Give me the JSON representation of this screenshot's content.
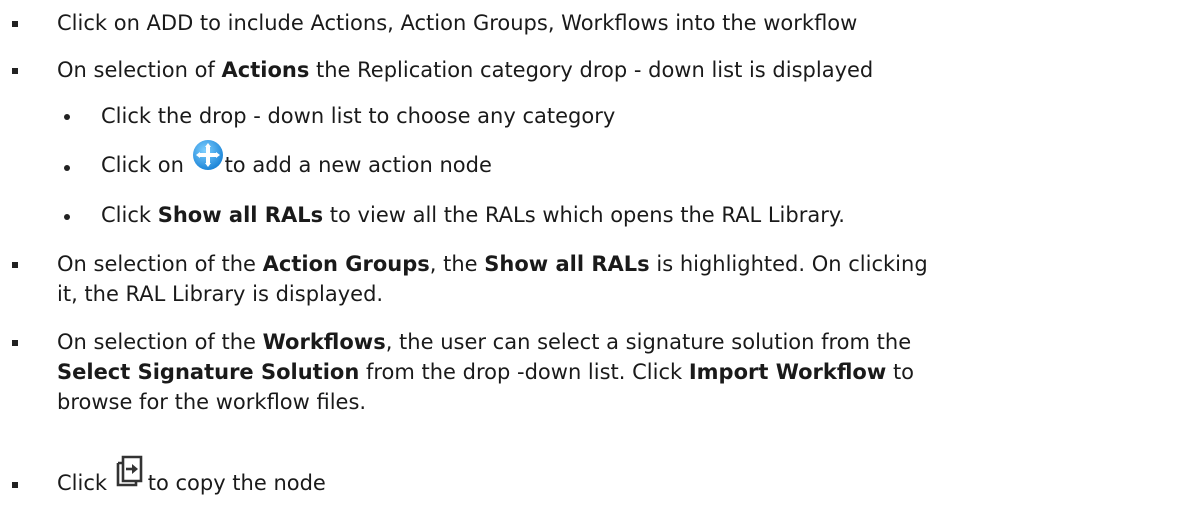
{
  "items": [
    {
      "text": "Click on ADD to include Actions, Action Groups, Workflows  into the workflow"
    },
    {
      "pre": "On selection of ",
      "bold": "Actions",
      "post": " the Replication category drop - down list is displayed"
    },
    {
      "text": "Click the drop - down list to choose any category"
    },
    {
      "pre": "Click on ",
      "icon": "plus-circle-icon",
      "post": "to add a new action node"
    },
    {
      "pre": "Click ",
      "bold": "Show all RALs",
      "post": " to view all the RALs which opens the RAL Library."
    },
    {
      "l1_pre": "On selection of the ",
      "l1_bold1": "Action Groups",
      "l1_mid": ", the ",
      "l1_bold2": "Show all RALs",
      "l1_post": " is highlighted. On clicking",
      "l2": "it, the RAL Library is displayed."
    },
    {
      "l1_pre": "On selection of the ",
      "l1_bold1": "Workflows",
      "l1_post": ", the user can select a signature solution from the",
      "l2_bold1": "Select Signature Solution",
      "l2_mid": " from the drop -down list. Click ",
      "l2_bold2": "Import Workflow",
      "l2_post": " to",
      "l3": "browse for the workflow files."
    },
    {
      "pre": "Click ",
      "icon": "copy-node-icon",
      "post": "to copy the node"
    }
  ]
}
